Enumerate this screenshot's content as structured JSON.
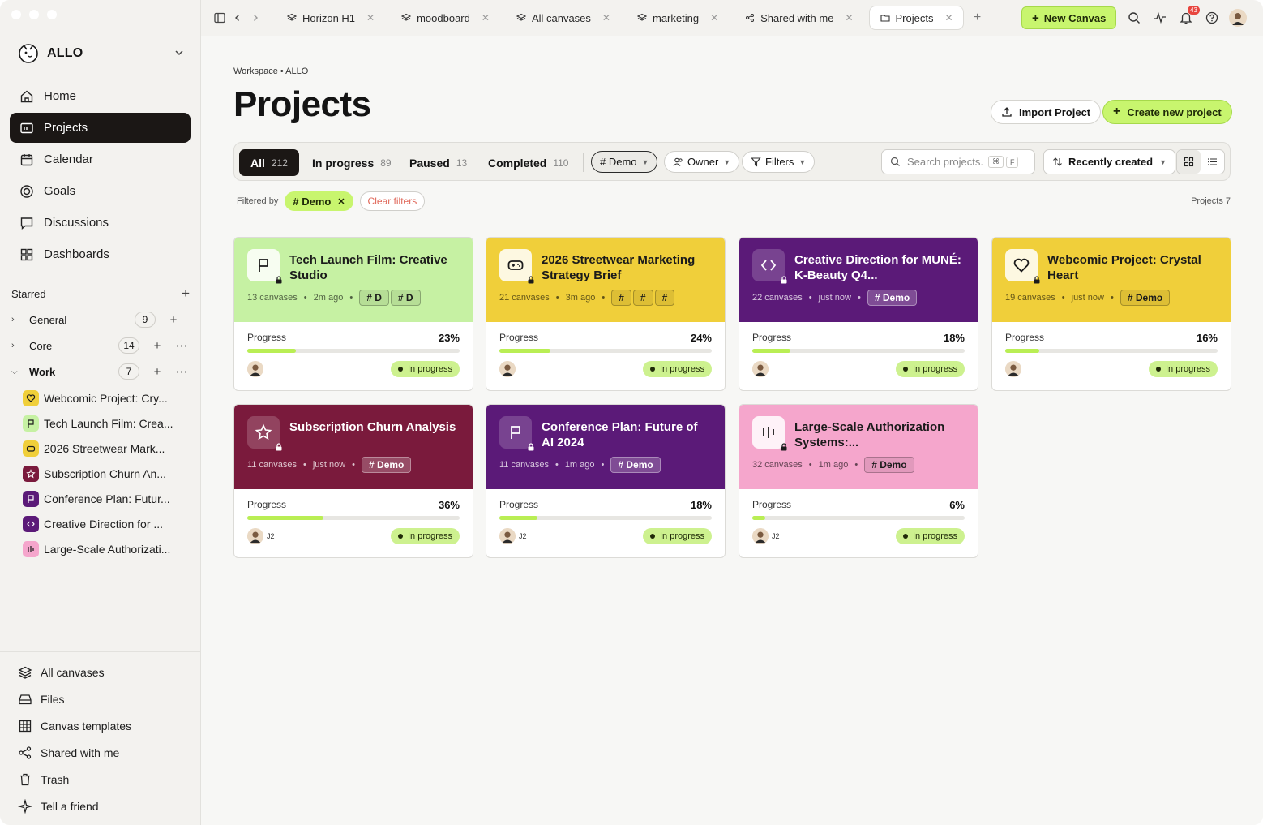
{
  "workspace": {
    "name": "ALLO"
  },
  "nav": [
    {
      "label": "Home",
      "icon": "home-icon"
    },
    {
      "label": "Projects",
      "icon": "projects-icon",
      "active": true
    },
    {
      "label": "Calendar",
      "icon": "calendar-icon"
    },
    {
      "label": "Goals",
      "icon": "goals-icon"
    },
    {
      "label": "Discussions",
      "icon": "discussions-icon"
    },
    {
      "label": "Dashboards",
      "icon": "dashboards-icon"
    }
  ],
  "starred": {
    "label": "Starred",
    "groups": [
      {
        "name": "General",
        "count": "9"
      },
      {
        "name": "Core",
        "count": "14"
      },
      {
        "name": "Work",
        "count": "7"
      }
    ],
    "work_items": [
      {
        "label": "Webcomic Project: Cry...",
        "color": "#f0cf3a"
      },
      {
        "label": "Tech Launch Film: Crea...",
        "color": "#c6f1a3"
      },
      {
        "label": "2026 Streetwear Mark...",
        "color": "#f0cf3a"
      },
      {
        "label": "Subscription Churn An...",
        "color": "#7a1a3c"
      },
      {
        "label": "Conference Plan: Futur...",
        "color": "#5b1a78"
      },
      {
        "label": "Creative Direction for ...",
        "color": "#5b1a78"
      },
      {
        "label": "Large-Scale Authorizati...",
        "color": "#f5a6cc"
      }
    ]
  },
  "bottom_nav": [
    {
      "label": "All canvases"
    },
    {
      "label": "Files"
    },
    {
      "label": "Canvas templates"
    },
    {
      "label": "Shared with me"
    },
    {
      "label": "Trash"
    },
    {
      "label": "Tell a friend"
    }
  ],
  "tabs": [
    {
      "label": "Horizon H1"
    },
    {
      "label": "moodboard"
    },
    {
      "label": "All canvases"
    },
    {
      "label": "marketing"
    },
    {
      "label": "Shared with me"
    },
    {
      "label": "Projects",
      "active": true
    }
  ],
  "topbar": {
    "new_canvas": "New Canvas",
    "notifications": "43"
  },
  "page": {
    "breadcrumb": "Workspace • ALLO",
    "title": "Projects",
    "import_label": "Import Project",
    "create_label": "Create new project"
  },
  "segments": [
    {
      "label": "All",
      "count": "212"
    },
    {
      "label": "In progress",
      "count": "89"
    },
    {
      "label": "Paused",
      "count": "13"
    },
    {
      "label": "Completed",
      "count": "110"
    }
  ],
  "filters": {
    "demo": "# Demo",
    "owner": "Owner",
    "filters": "Filters",
    "search_placeholder": "Search projects.",
    "kbd1": "⌘",
    "kbd2": "F",
    "sort": "Recently created",
    "filtered_by": "Filtered by",
    "active_filter": "# Demo",
    "clear": "Clear filters",
    "count_label": "Projects 7"
  },
  "cards": [
    {
      "title": "Tech Launch Film: Creative Studio",
      "canvases": "13 canvases",
      "time": "2m ago",
      "tags": [
        "# D",
        "# D"
      ],
      "progress_label": "Progress",
      "progress": "23%",
      "pct": 23,
      "status": "In progress",
      "user": "",
      "bg": "#c6f1a3",
      "fg": "#1b1b1b",
      "icon": "flag-icon"
    },
    {
      "title": "2026 Streetwear Marketing Strategy Brief",
      "canvases": "21 canvases",
      "time": "3m ago",
      "tags": [
        "#",
        "#",
        "#"
      ],
      "progress_label": "Progress",
      "progress": "24%",
      "pct": 24,
      "status": "In progress",
      "user": "",
      "bg": "#f0cf3a",
      "fg": "#1b1b1b",
      "icon": "gamepad-icon"
    },
    {
      "title": "Creative Direction for MUNÉ: K-Beauty Q4...",
      "canvases": "22 canvases",
      "time": "just now",
      "tags": [
        "# Demo"
      ],
      "progress_label": "Progress",
      "progress": "18%",
      "pct": 18,
      "status": "In progress",
      "user": "",
      "bg": "#5b1a78",
      "fg": "#ffffff",
      "icon": "code-icon"
    },
    {
      "title": "Webcomic Project: Crystal Heart",
      "canvases": "19 canvases",
      "time": "just now",
      "tags": [
        "# Demo"
      ],
      "progress_label": "Progress",
      "progress": "16%",
      "pct": 16,
      "status": "In progress",
      "user": "",
      "bg": "#f0cf3a",
      "fg": "#1b1b1b",
      "icon": "heart-icon"
    },
    {
      "title": "Subscription Churn Analysis",
      "canvases": "11 canvases",
      "time": "just now",
      "tags": [
        "# Demo"
      ],
      "progress_label": "Progress",
      "progress": "36%",
      "pct": 36,
      "status": "In progress",
      "user": "J2",
      "bg": "#7a1a3c",
      "fg": "#ffffff",
      "icon": "star-icon"
    },
    {
      "title": "Conference Plan: Future of AI 2024",
      "canvases": "11 canvases",
      "time": "1m ago",
      "tags": [
        "# Demo"
      ],
      "progress_label": "Progress",
      "progress": "18%",
      "pct": 18,
      "status": "In progress",
      "user": "J2",
      "bg": "#5b1a78",
      "fg": "#ffffff",
      "icon": "flag-icon"
    },
    {
      "title": "Large-Scale Authorization Systems:...",
      "canvases": "32 canvases",
      "time": "1m ago",
      "tags": [
        "# Demo"
      ],
      "progress_label": "Progress",
      "progress": "6%",
      "pct": 6,
      "status": "In progress",
      "user": "J2",
      "bg": "#f5a6cc",
      "fg": "#1b1b1b",
      "icon": "pause-bars-icon"
    }
  ]
}
